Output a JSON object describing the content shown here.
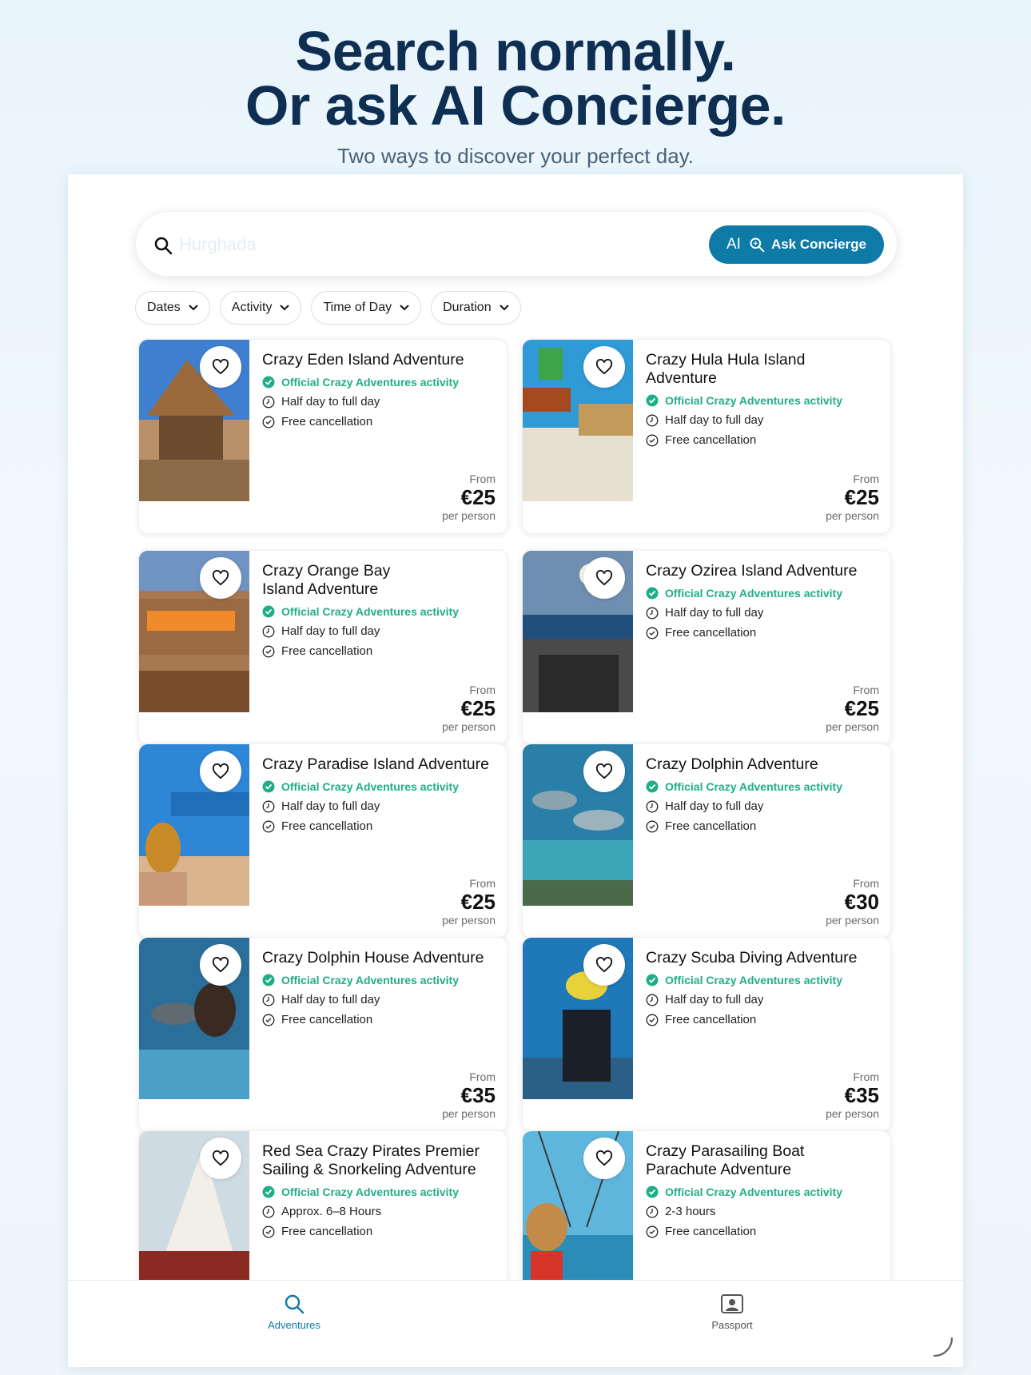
{
  "hero": {
    "title_line1": "Search normally.",
    "title_line2": "Or ask AI Concierge.",
    "subtitle": "Two ways to discover your perfect day."
  },
  "search": {
    "placeholder": "Hurghada",
    "concierge_ai": "AI",
    "concierge_label": "Ask Concierge"
  },
  "filters": [
    "Dates",
    "Activity",
    "Time of Day",
    "Duration"
  ],
  "official_label": "Official Crazy Adventures activity",
  "price_from": "From",
  "price_per": "per person",
  "cards": [
    {
      "title": "Crazy Eden Island Adventure",
      "duration": "Half day to full day",
      "cancel": "Free cancellation",
      "price": "€25"
    },
    {
      "title": "Crazy Hula Hula Island Adventure",
      "duration": "Half day to full day",
      "cancel": "Free cancellation",
      "price": "€25"
    },
    {
      "title": "Crazy Orange Bay Island Adventure",
      "duration": "Half day to full day",
      "cancel": "Free cancellation",
      "price": "€25"
    },
    {
      "title": "Crazy Ozirea Island Adventure",
      "duration": "Half day to full day",
      "cancel": "Free cancellation",
      "price": "€25"
    },
    {
      "title": "Crazy Paradise Island Adventure",
      "duration": "Half day to full day",
      "cancel": "Free cancellation",
      "price": "€25"
    },
    {
      "title": "Crazy Dolphin Adventure",
      "duration": "Half day to full day",
      "cancel": "Free cancellation",
      "price": "€30"
    },
    {
      "title": "Crazy Dolphin House Adventure",
      "duration": "Half day to full day",
      "cancel": "Free cancellation",
      "price": "€35"
    },
    {
      "title": "Crazy Scuba Diving Adventure",
      "duration": "Half day to full day",
      "cancel": "Free cancellation",
      "price": "€35"
    },
    {
      "title": "Red Sea Crazy Pirates Premier Sailing & Snorkeling Adventure",
      "duration": "Approx. 6–8 Hours",
      "cancel": "Free cancellation",
      "price": ""
    },
    {
      "title": "Crazy Parasailing Boat Parachute Adventure",
      "duration": "2-3 hours",
      "cancel": "Free cancellation",
      "price": ""
    }
  ],
  "tabs": {
    "adventures": "Adventures",
    "passport": "Passport"
  },
  "colors": {
    "brand": "#0e7aa6",
    "title": "#0f2f52",
    "official": "#1fae87"
  }
}
